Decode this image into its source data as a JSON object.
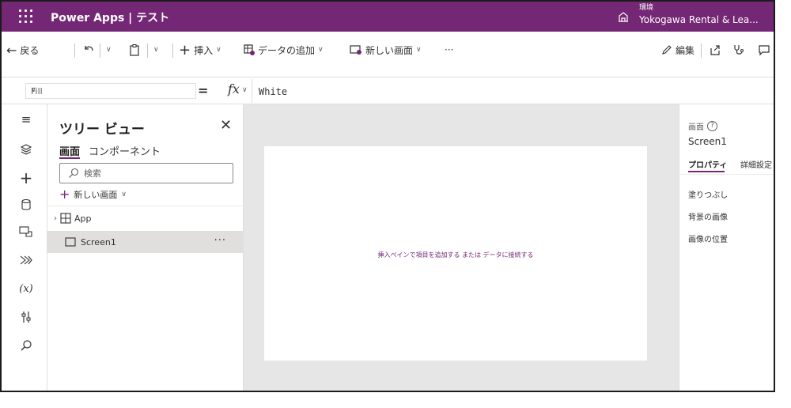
{
  "header": {
    "app_title": "Power Apps | テスト",
    "env_label": "環境",
    "env_name": "Yokogawa Rental & Lea..."
  },
  "commandbar": {
    "back": "戻る",
    "insert": "挿入",
    "add_data": "データの追加",
    "new_screen": "新しい画面",
    "more": "···",
    "edit": "編集"
  },
  "formulabar": {
    "property": "Fill",
    "formula": "White"
  },
  "tree": {
    "title": "ツリー ビュー",
    "tab_screens": "画面",
    "tab_components": "コンポーネント",
    "search_placeholder": "検索",
    "new_screen": "新しい画面",
    "nodes": [
      {
        "label": "App"
      },
      {
        "label": "Screen1"
      }
    ]
  },
  "canvas": {
    "hint": "挿入ペインで項目を追加する または データに接続する"
  },
  "properties": {
    "type_label": "画面",
    "name": "Screen1",
    "tab_properties": "プロパティ",
    "tab_advanced": "詳細設定",
    "rows": [
      "塗りつぶし",
      "背景の画像",
      "画像の位置"
    ]
  },
  "colors": {
    "brand": "#742774",
    "canvas": "#e6e6e6"
  }
}
